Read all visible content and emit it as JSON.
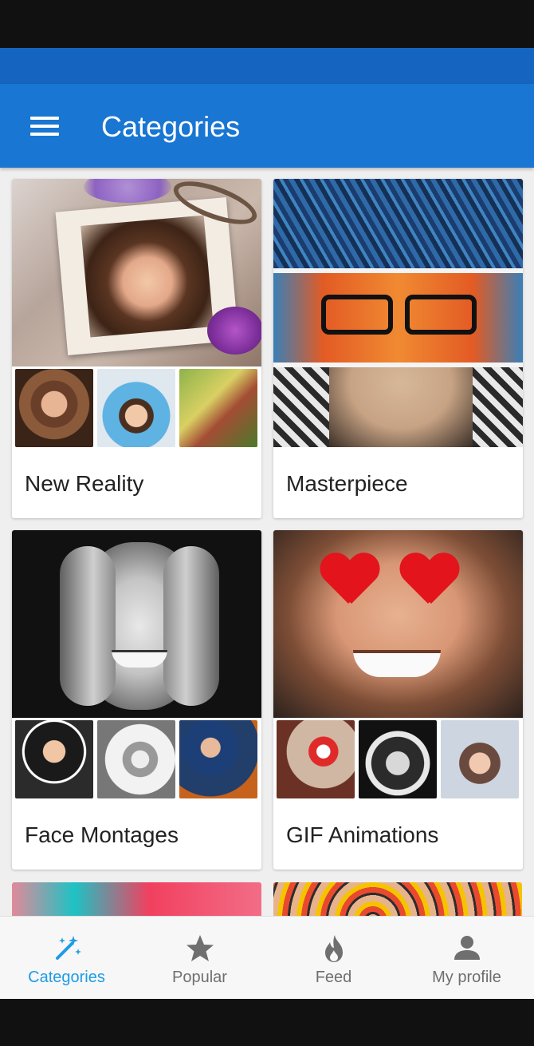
{
  "app_bar": {
    "title": "Categories",
    "menu_icon": "hamburger-menu-icon",
    "color": "#1976d2",
    "status_bar_color": "#1565c0"
  },
  "categories": [
    {
      "label": "New Reality"
    },
    {
      "label": "Masterpiece"
    },
    {
      "label": "Face Montages"
    },
    {
      "label": "GIF Animations"
    }
  ],
  "bottom_nav": {
    "active_color": "#1e9be6",
    "inactive_color": "#6f6f6f",
    "items": [
      {
        "label": "Categories",
        "icon": "magic-wand-icon",
        "active": true
      },
      {
        "label": "Popular",
        "icon": "star-icon",
        "active": false
      },
      {
        "label": "Feed",
        "icon": "flame-icon",
        "active": false
      },
      {
        "label": "My profile",
        "icon": "person-icon",
        "active": false
      }
    ]
  }
}
